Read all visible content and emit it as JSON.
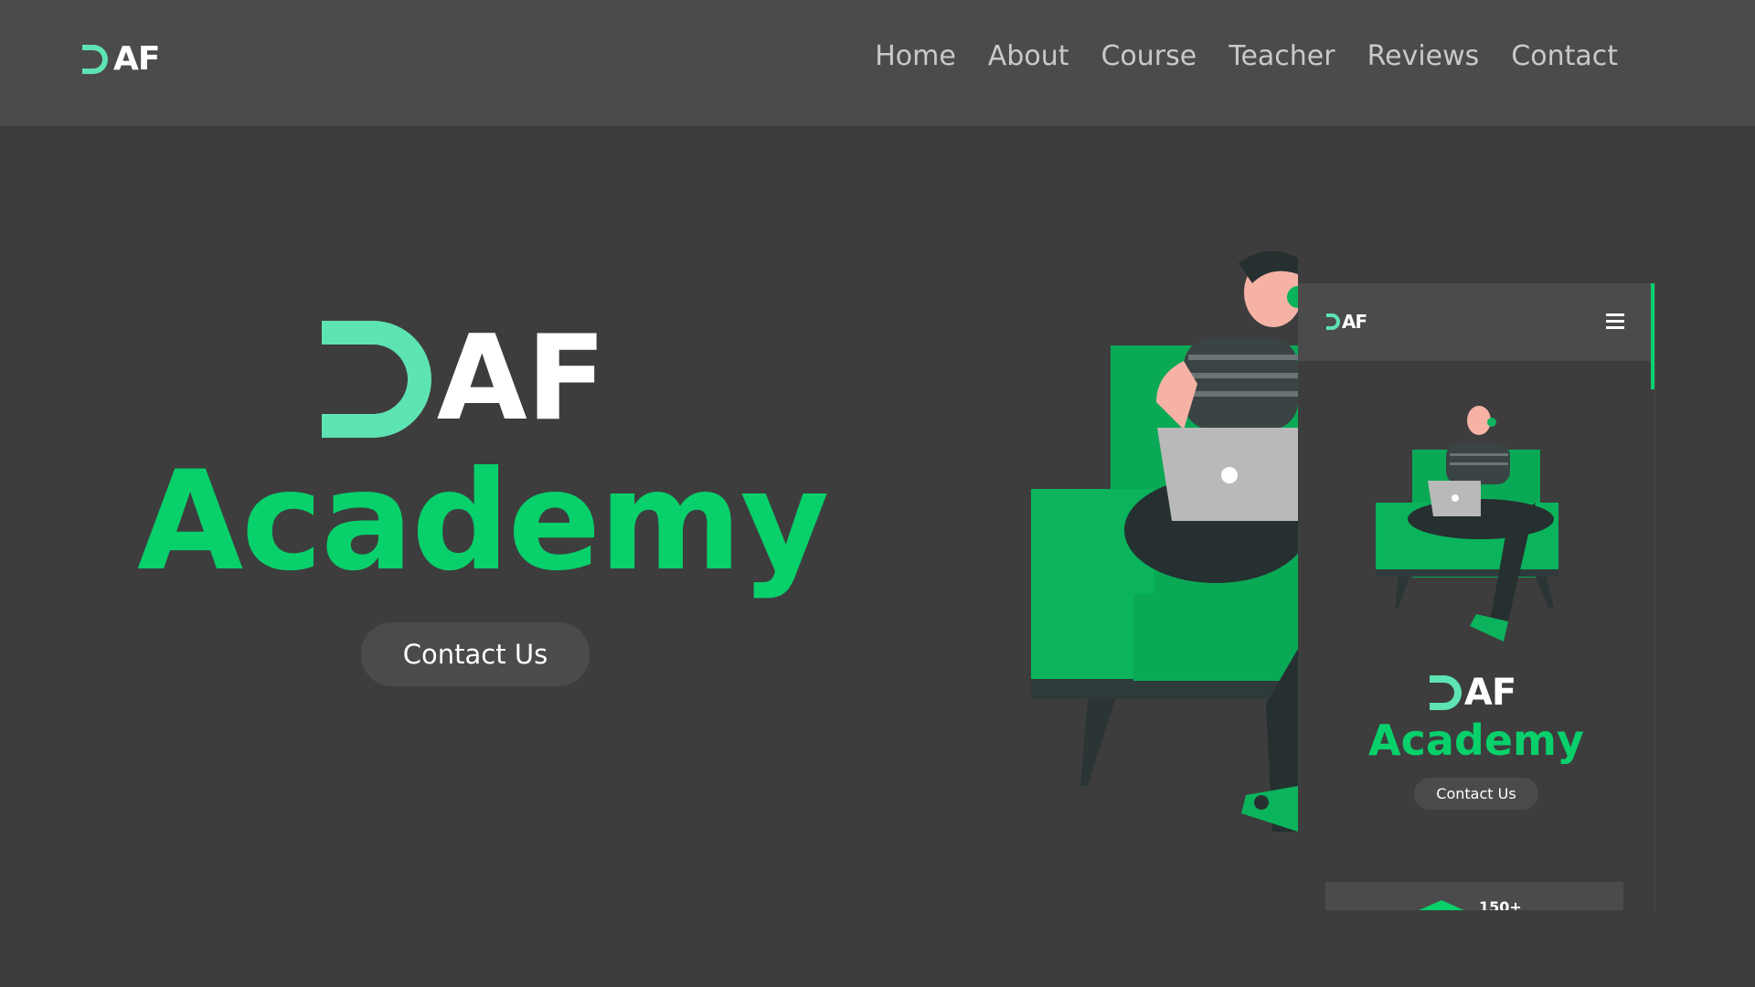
{
  "brand": {
    "logo_text": "AF",
    "accent_color": "#08d06b",
    "logo_mark_color": "#5ee3b3"
  },
  "nav": {
    "items": [
      {
        "label": "Home"
      },
      {
        "label": "About"
      },
      {
        "label": "Course"
      },
      {
        "label": "Teacher"
      },
      {
        "label": "Reviews"
      },
      {
        "label": "Contact"
      }
    ]
  },
  "hero": {
    "logo_text": "AF",
    "title": "Academy",
    "cta_label": "Contact Us",
    "illustration_icon": "person-on-armchair-with-laptop-illustration"
  },
  "mobile_preview": {
    "logo_text": "AF",
    "menu_icon": "hamburger-menu-icon",
    "title": "Academy",
    "cta_label": "Contact Us",
    "stat_value": "150+",
    "stat_icon": "graduation-cap-icon"
  }
}
